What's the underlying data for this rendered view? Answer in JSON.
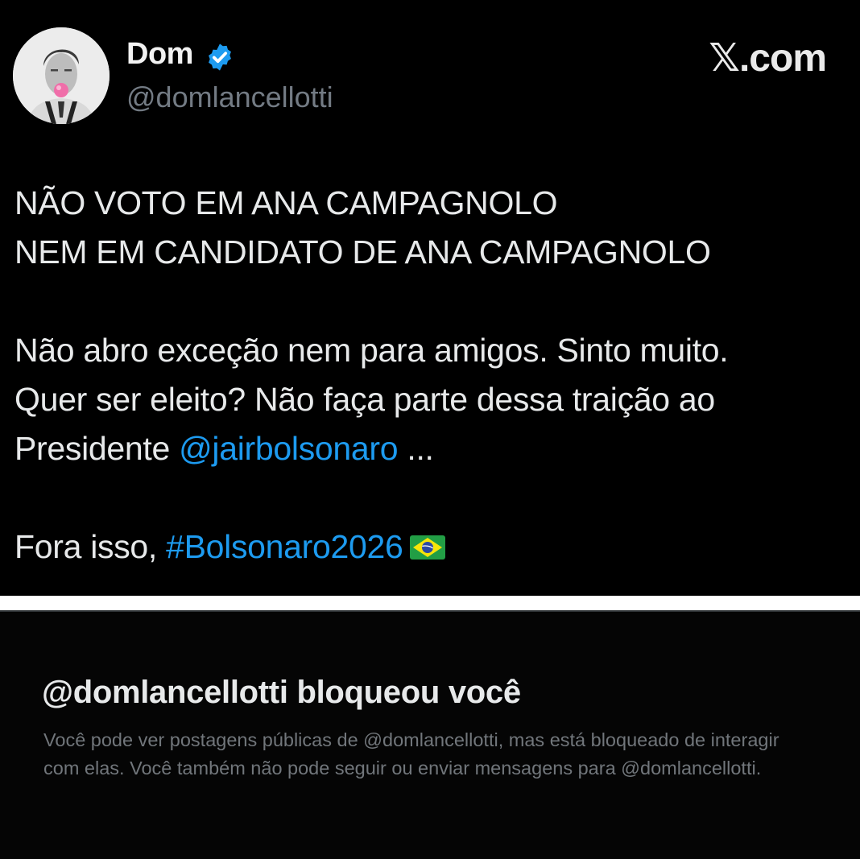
{
  "tweet": {
    "author": {
      "display_name": "Dom",
      "handle": "@domlancellotti",
      "verified": true,
      "avatar_icon": "profile-photo-icon"
    },
    "source": "𝕏.com",
    "body": {
      "line1": "NÃO VOTO EM ANA CAMPAGNOLO",
      "line2": "NEM EM CANDIDATO DE ANA CAMPAGNOLO",
      "line3": "Não abro exceção nem para amigos. Sinto muito.",
      "line4": "Quer ser eleito? Não faça parte dessa traição ao",
      "line5_prefix": "Presidente ",
      "mention": "@jairbolsonaro",
      "line5_suffix": " ...",
      "line6_prefix": "Fora isso, ",
      "hashtag": "#Bolsonaro2026",
      "flag_icon": "brazil-flag-icon"
    },
    "colors": {
      "link": "#1d9bf0",
      "verified_badge": "#1d9bf0",
      "text": "#e7e9ea",
      "muted": "#71767b"
    }
  },
  "blocked_notice": {
    "title": "@domlancellotti bloqueou você",
    "message": "Você pode ver postagens públicas de @domlancellotti, mas está bloqueado de interagir com elas. Você também não pode seguir ou enviar mensagens para @domlancellotti."
  }
}
